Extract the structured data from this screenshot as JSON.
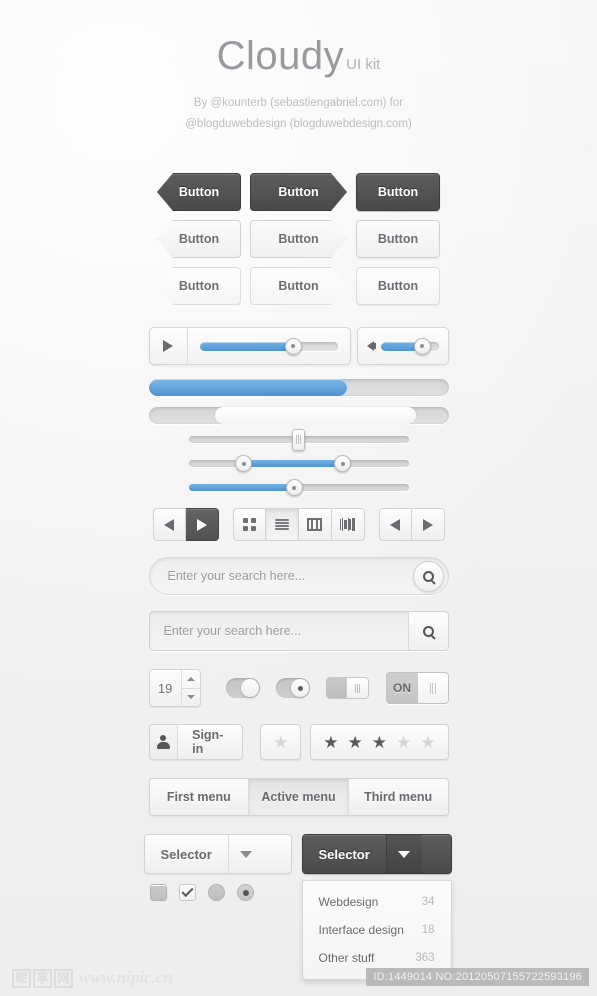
{
  "header": {
    "brand": "Cloudy",
    "brand_suffix": "UI kit",
    "credit_line1": "By @kounterb (sebastiengabriel.com) for",
    "credit_line2": "@blogduwebdesign (blogduwebdesign.com)"
  },
  "buttons": {
    "rows": [
      {
        "style": "dark",
        "items": [
          {
            "label": "Button"
          },
          {
            "label": "Button"
          },
          {
            "label": "Button"
          }
        ]
      },
      {
        "style": "light",
        "items": [
          {
            "label": "Button"
          },
          {
            "label": "Button"
          },
          {
            "label": "Button"
          }
        ]
      },
      {
        "style": "soft",
        "items": [
          {
            "label": "Button"
          },
          {
            "label": "Button"
          },
          {
            "label": "Button"
          }
        ]
      }
    ]
  },
  "player": {
    "play_icon": "play-icon",
    "progress_percent": 68,
    "volume_icon": "speaker-icon",
    "volume_percent": 72
  },
  "progress_bars": [
    {
      "name": "blue-progress",
      "percent": 66
    },
    {
      "name": "inset-progress",
      "percent": 67
    }
  ],
  "sliders": [
    {
      "name": "single-grip-slider",
      "value_percent": 50,
      "handle": "vertical-grip"
    },
    {
      "name": "range-slider",
      "start_percent": 25,
      "end_percent": 70,
      "handle": "round"
    },
    {
      "name": "value-slider",
      "value_percent": 48,
      "handle": "round"
    }
  ],
  "toolbar": {
    "nav_left": {
      "icon": "arrow-left-icon",
      "state": "normal"
    },
    "nav_right": {
      "icon": "arrow-right-icon",
      "state": "active"
    },
    "views": [
      {
        "icon": "grid-view-icon",
        "state": "normal"
      },
      {
        "icon": "list-view-icon",
        "state": "pressed"
      },
      {
        "icon": "column-view-icon",
        "state": "normal"
      },
      {
        "icon": "detail-view-icon",
        "state": "normal"
      }
    ],
    "pager_prev": {
      "icon": "arrow-left-icon"
    },
    "pager_next": {
      "icon": "arrow-right-icon"
    }
  },
  "search": {
    "rounded_placeholder": "Enter your search here...",
    "square_placeholder": "Enter your search here...",
    "icon": "search-icon"
  },
  "controls": {
    "stepper_value": "19",
    "toggle_plain": {
      "name": "toggle-switch-plain",
      "state": "on"
    },
    "toggle_dot": {
      "name": "toggle-switch-dot",
      "state": "on"
    },
    "toggle_square": {
      "name": "toggle-switch-square",
      "state": "off"
    },
    "toggle_labeled": {
      "name": "toggle-switch-labeled",
      "label": "ON",
      "state": "on"
    }
  },
  "signin": {
    "label": "Sign-in",
    "icon": "person-icon"
  },
  "rating": {
    "single_star_filled": false,
    "stars": [
      true,
      true,
      true,
      false,
      false
    ],
    "total": 5
  },
  "menus": [
    {
      "label": "First menu",
      "active": false
    },
    {
      "label": "Active menu",
      "active": true
    },
    {
      "label": "Third menu",
      "active": false
    }
  ],
  "selectors": {
    "light": {
      "label": "Selector",
      "caret": "chevron-down-icon"
    },
    "dark": {
      "label": "Selector",
      "caret": "chevron-down-icon"
    },
    "dropdown_items": [
      {
        "label": "Webdesign",
        "count": "34"
      },
      {
        "label": "Interface design",
        "count": "18"
      },
      {
        "label": "Other stuff",
        "count": "363"
      }
    ]
  },
  "choices": [
    {
      "name": "checkbox-filled",
      "type": "checkbox",
      "checked": false,
      "filled": true
    },
    {
      "name": "checkbox-checked",
      "type": "checkbox",
      "checked": true,
      "filled": false
    },
    {
      "name": "radio-empty",
      "type": "radio",
      "selected": false
    },
    {
      "name": "radio-selected",
      "type": "radio",
      "selected": true
    }
  ],
  "footer": {
    "watermark_chars": [
      "昵",
      "享",
      "网"
    ],
    "watermark_url": "www.nipic.cn",
    "id_badge": "ID:1449014 NO:20120507155722593196"
  },
  "colors": {
    "accent_blue": "#4f94d4",
    "dark_button": "#4f4f4f",
    "page_bg": "#f2f2f2",
    "text_gray": "#6a6a6e"
  }
}
